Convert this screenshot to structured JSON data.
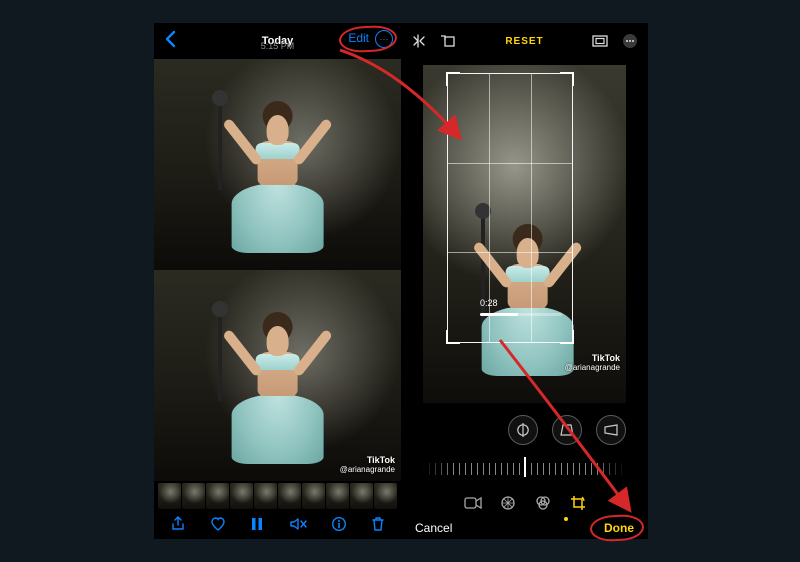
{
  "left": {
    "title": "Today",
    "subtitle": "5:15 PM",
    "edit_label": "Edit",
    "more_glyph": "⋯",
    "watermark_brand": "TikTok",
    "watermark_handle": "@arianagrande",
    "toolbar": {
      "share": "share-icon",
      "favorite": "heart-icon",
      "pause": "pause-icon",
      "mute": "speaker-muted-icon",
      "info": "info-icon",
      "trash": "trash-icon"
    }
  },
  "right": {
    "reset_label": "RESET",
    "timecode": "0:28",
    "cancel_label": "Cancel",
    "done_label": "Done",
    "circle_buttons": {
      "straighten": "straighten-icon",
      "vertical_perspective": "vertical-perspective-icon",
      "horizontal_perspective": "horizontal-perspective-icon"
    },
    "tabs": {
      "video": "video-icon",
      "adjust": "adjust-icon",
      "filters": "filters-icon",
      "crop": "crop-icon"
    }
  },
  "colors": {
    "ios_blue": "#0a84ff",
    "ios_yellow": "#ffd60a",
    "annotation_red": "#d62828"
  }
}
